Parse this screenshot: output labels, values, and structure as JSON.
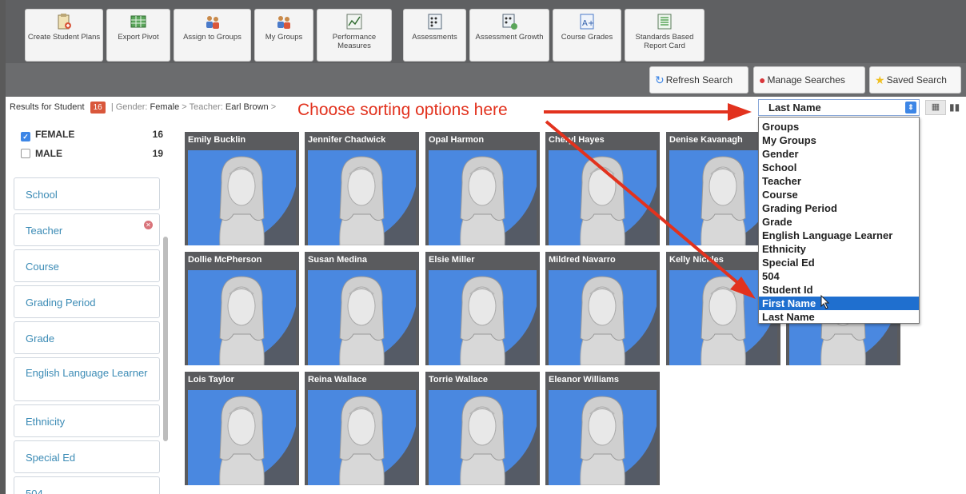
{
  "toolbar": {
    "buttons": [
      {
        "label": "Create Student Plans",
        "icon": "clipboard-plus-icon"
      },
      {
        "label": "Export Pivot",
        "icon": "spreadsheet-icon"
      },
      {
        "label": "Assign to Groups",
        "icon": "people-group-icon"
      },
      {
        "label": "My Groups",
        "icon": "people-group-icon"
      },
      {
        "label": "Performance Measures",
        "icon": "line-chart-icon"
      },
      {
        "label": "Assessments",
        "icon": "checklist-icon"
      },
      {
        "label": "Assessment Growth",
        "icon": "checklist-growth-icon"
      },
      {
        "label": "Course Grades",
        "icon": "grade-a-plus-icon"
      },
      {
        "label": "Standards Based Report Card",
        "icon": "report-card-icon"
      }
    ]
  },
  "search": {
    "refresh_label": "Refresh Search",
    "manage_label": "Manage Searches",
    "saved_label": "Saved Search"
  },
  "results": {
    "prefix": "Results for Student",
    "count": "16",
    "crumb_gender_key": "Gender:",
    "crumb_gender_val": "Female",
    "crumb_teacher_key": "Teacher:",
    "crumb_teacher_val": "Earl Brown",
    "separator": ">"
  },
  "annotation": "Choose sorting options here",
  "sort": {
    "selected": "Last Name",
    "options": [
      "Groups",
      "My Groups",
      "Gender",
      "School",
      "Teacher",
      "Course",
      "Grading Period",
      "Grade",
      "English Language Learner",
      "Ethnicity",
      "Special Ed",
      "504",
      "Student Id",
      "First Name",
      "Last Name"
    ],
    "highlighted": "First Name"
  },
  "filters": {
    "gender": [
      {
        "label": "FEMALE",
        "count": "16",
        "checked": true
      },
      {
        "label": "MALE",
        "count": "19",
        "checked": false
      }
    ],
    "facets": [
      "School",
      "Teacher",
      "Course",
      "Grading Period",
      "Grade",
      "English Language Learner",
      "Ethnicity",
      "Special Ed",
      "504"
    ]
  },
  "students": [
    "Emily Bucklin",
    "Jennifer Chadwick",
    "Opal Harmon",
    "Cheryl Hayes",
    "Denise Kavanagh",
    "Dollie McPherson",
    "Susan Medina",
    "Elsie Miller",
    "Mildred Navarro",
    "Kelly Nickles",
    "",
    "Lois Taylor",
    "Reina Wallace",
    "Torrie Wallace",
    "Eleanor Williams"
  ],
  "colors": {
    "accent": "#3d86e6",
    "annotation": "#e2321e",
    "card_bg": "#4a88e0"
  }
}
